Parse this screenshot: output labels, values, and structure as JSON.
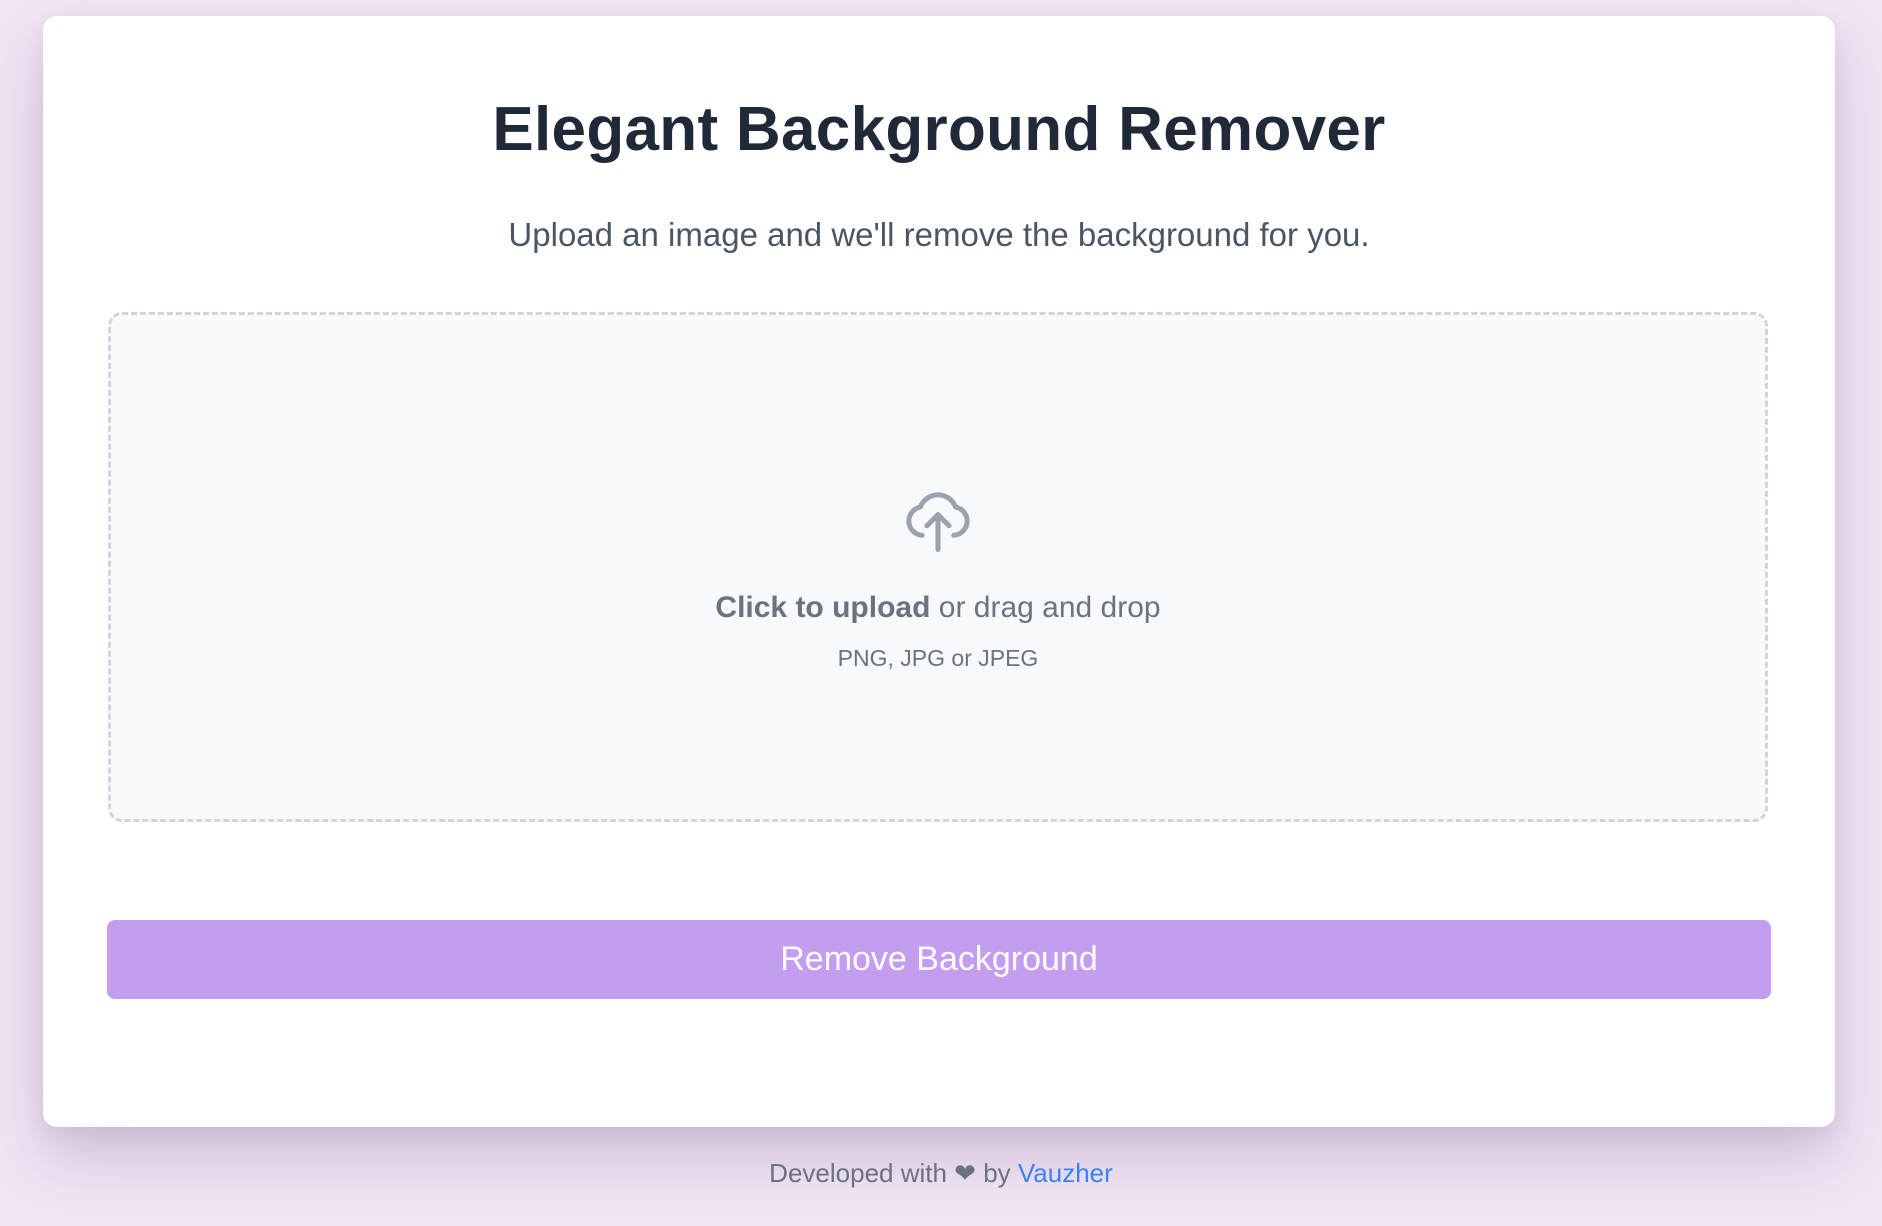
{
  "header": {
    "title": "Elegant Background Remover",
    "subtitle": "Upload an image and we'll remove the background for you."
  },
  "upload": {
    "icon": "cloud-upload-icon",
    "click_label": "Click to upload",
    "drag_label": " or drag and drop",
    "formats": "PNG, JPG or JPEG"
  },
  "actions": {
    "remove_label": "Remove Background"
  },
  "footer": {
    "prefix": "Developed with ",
    "heart": "❤",
    "middle": " by ",
    "author": "Vauzher"
  },
  "colors": {
    "page_background": "#f1e5f5",
    "accent_button": "#c49df0",
    "link": "#3b82f6",
    "title": "#1f2937",
    "muted_text": "#6b7280"
  }
}
